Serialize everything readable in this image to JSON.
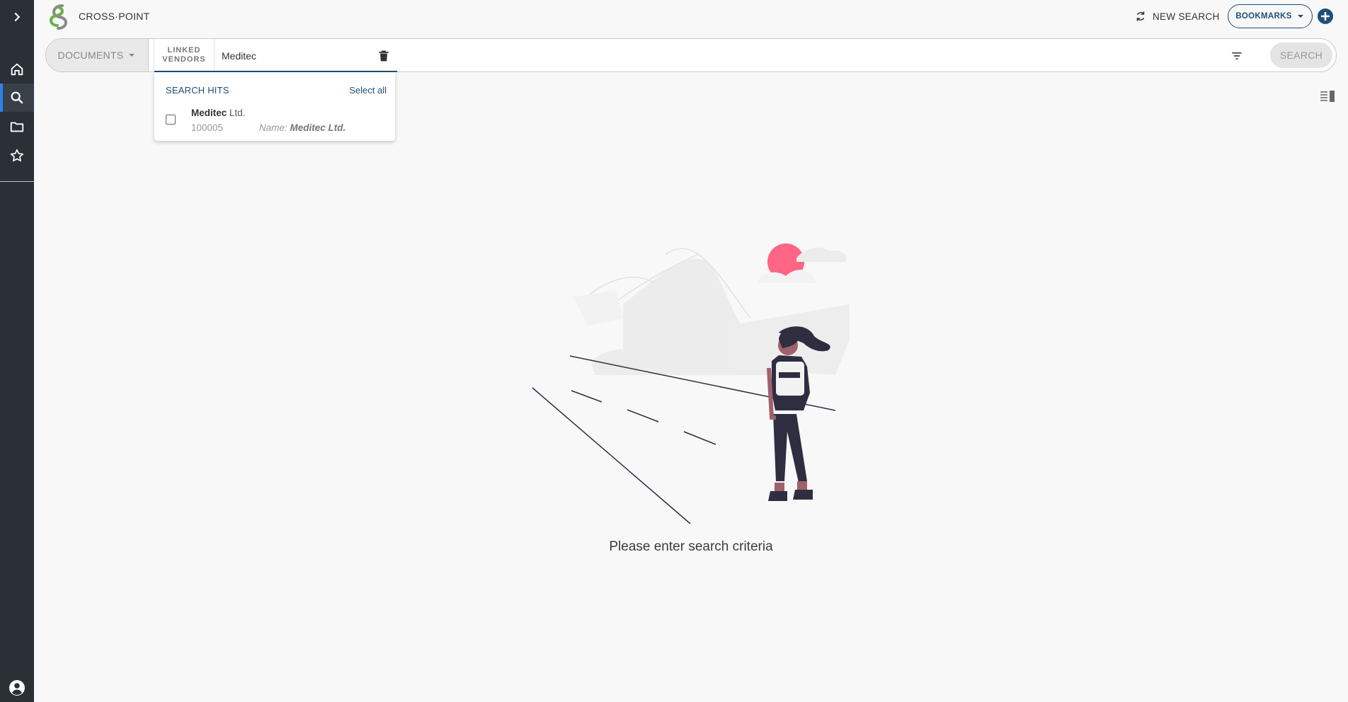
{
  "app": {
    "title": "CROSS·POINT"
  },
  "header": {
    "new_search_label": "NEW SEARCH",
    "bookmarks_label": "BOOKMARKS"
  },
  "sidebar": {
    "items": [
      {
        "name": "expand",
        "icon": "chevron-right-icon"
      },
      {
        "name": "home",
        "icon": "home-icon"
      },
      {
        "name": "search",
        "icon": "search-icon",
        "active": true
      },
      {
        "name": "folder",
        "icon": "folder-icon"
      },
      {
        "name": "favorites",
        "icon": "star-icon"
      }
    ],
    "bottom_icon": "account-circle-icon"
  },
  "search": {
    "type_label": "DOCUMENTS",
    "chip_label_line1": "LINKED",
    "chip_label_line2": "VENDORS",
    "query": "Meditec",
    "button_label": "SEARCH"
  },
  "dropdown": {
    "title": "SEARCH HITS",
    "select_all": "Select all",
    "hits": [
      {
        "name_match": "Meditec",
        "name_rest": " Ltd.",
        "id": "100005",
        "match_prefix": "Name: ",
        "match_value": "Meditec Ltd.",
        "checked": false
      }
    ]
  },
  "main": {
    "empty_message": "Please enter search criteria"
  },
  "colors": {
    "accent": "#1f4e79",
    "sidebar": "#2b3036",
    "active_indicator": "#2f80ed",
    "sun": "#ff6584",
    "figure": "#2f2e41"
  }
}
